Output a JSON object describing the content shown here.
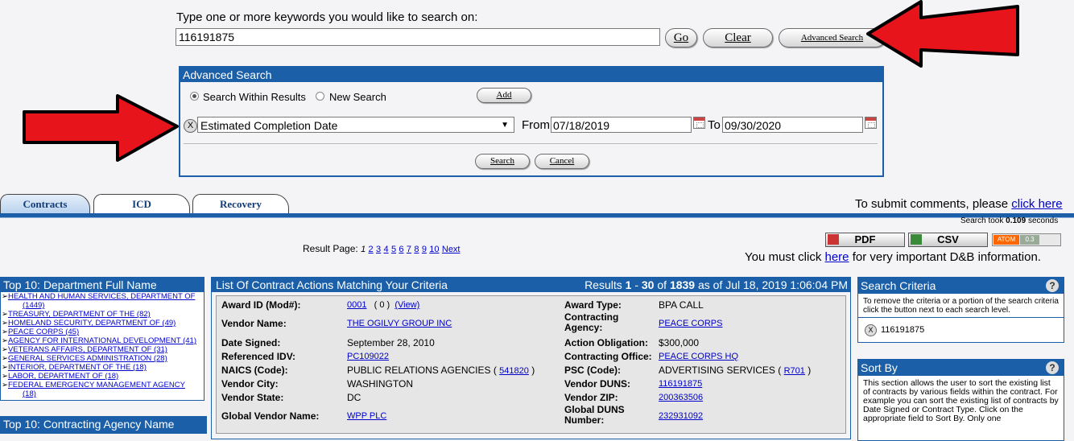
{
  "search": {
    "prompt": "Type one or more keywords you would like to search on:",
    "value": "116191875",
    "go_label": "Go",
    "clear_label": "Clear",
    "advanced_label": "Advanced Search"
  },
  "advanced": {
    "title": "Advanced Search",
    "radio_within": "Search Within Results",
    "radio_new": "New Search",
    "add_label": "Add",
    "remove_label": "X",
    "field_selected": "Estimated Completion Date",
    "from_label": "From",
    "from_value": "07/18/2019",
    "to_label": "To",
    "to_value": "09/30/2020",
    "search_label": "Search",
    "cancel_label": "Cancel"
  },
  "tabs": [
    {
      "label": "Contracts"
    },
    {
      "label": "ICD"
    },
    {
      "label": "Recovery"
    }
  ],
  "comments": {
    "prefix": "To submit comments, please ",
    "link": "click here"
  },
  "timing": {
    "prefix": "Search took ",
    "value": "0.109",
    "suffix": " seconds"
  },
  "pagination": {
    "label": "Result Page:",
    "current": "1",
    "pages": [
      "2",
      "3",
      "4",
      "5",
      "6",
      "7",
      "8",
      "9",
      "10"
    ],
    "next": "Next"
  },
  "export": {
    "pdf": "PDF",
    "csv": "CSV",
    "atom_a": "ATOM",
    "atom_b": "0.3"
  },
  "dnb": {
    "prefix": "You must click ",
    "link": "here",
    "suffix": " for very important D&B information."
  },
  "top10_dept": {
    "title": "Top 10: Department Full Name",
    "items": [
      {
        "name": "HEALTH AND HUMAN SERVICES, DEPARTMENT OF",
        "count": "(1449)"
      },
      {
        "name": "TREASURY, DEPARTMENT OF THE (82)",
        "count": ""
      },
      {
        "name": "HOMELAND SECURITY, DEPARTMENT OF (49)",
        "count": ""
      },
      {
        "name": "PEACE CORPS (45)",
        "count": ""
      },
      {
        "name": "AGENCY FOR INTERNATIONAL DEVELOPMENT (41)",
        "count": ""
      },
      {
        "name": "VETERANS AFFAIRS, DEPARTMENT OF (31)",
        "count": ""
      },
      {
        "name": "GENERAL SERVICES ADMINISTRATION (28)",
        "count": ""
      },
      {
        "name": "INTERIOR, DEPARTMENT OF THE (18)",
        "count": ""
      },
      {
        "name": "LABOR, DEPARTMENT OF (18)",
        "count": ""
      },
      {
        "name": "FEDERAL EMERGENCY MANAGEMENT AGENCY",
        "count": "(18)"
      }
    ]
  },
  "top10_agency": {
    "title": "Top 10: Contracting Agency Name"
  },
  "results": {
    "title": "List Of Contract Actions Matching Your Criteria",
    "summary_prefix": "Results ",
    "range_start": "1",
    "range_sep": " - ",
    "range_end": "30",
    "of": " of ",
    "total": "1839",
    "as_of": " as of Jul 18, 2019 1:06:04 PM"
  },
  "record": {
    "award_id_label": "Award ID (Mod#):",
    "award_id": "0001",
    "mod": "( 0 )",
    "view": "(View)",
    "vendor_name_label": "Vendor Name:",
    "vendor_name": "THE OGILVY GROUP INC",
    "date_signed_label": "Date Signed:",
    "date_signed": "September 28, 2010",
    "ref_idv_label": "Referenced IDV:",
    "ref_idv": "PC109022",
    "naics_label": "NAICS (Code):",
    "naics": "PUBLIC RELATIONS AGENCIES (",
    "naics_code": "541820",
    "naics_close": ")",
    "vendor_city_label": "Vendor City:",
    "vendor_city": "WASHINGTON",
    "vendor_state_label": "Vendor State:",
    "vendor_state": "DC",
    "global_vendor_label": "Global Vendor Name:",
    "global_vendor": "WPP PLC",
    "award_type_label": "Award Type:",
    "award_type": "BPA CALL",
    "contracting_agency_label_1": "Contracting",
    "contracting_agency_label_2": "Agency:",
    "contracting_agency": "PEACE CORPS",
    "action_obligation_label": "Action Obligation:",
    "action_obligation": "$300,000",
    "contracting_office_label": "Contracting Office:",
    "contracting_office": "PEACE CORPS HQ",
    "psc_label": "PSC (Code):",
    "psc": "ADVERTISING SERVICES (",
    "psc_code": "R701",
    "psc_close": ")",
    "vendor_duns_label": "Vendor DUNS:",
    "vendor_duns": "116191875",
    "vendor_zip_label": "Vendor ZIP:",
    "vendor_zip": "200363506",
    "global_duns_label_1": "Global DUNS",
    "global_duns_label_2": "Number:",
    "global_duns": "232931092"
  },
  "search_criteria": {
    "title": "Search Criteria",
    "help": "?",
    "description": "To remove the criteria or a portion of the search criteria click the button next to each search level.",
    "x": "X",
    "value": "116191875"
  },
  "sort_by": {
    "title": "Sort By",
    "help": "?",
    "description": "This section allows the user to sort the existing list of contracts by various fields within the contract. For example you can sort the existing list of contracts by Date Signed or Contract Type. Click on the appropriate field to Sort By. Only one"
  },
  "colors": {
    "header_blue": "#1a5fa8",
    "link": "#0000cc",
    "arrow_red": "#e8141c"
  }
}
